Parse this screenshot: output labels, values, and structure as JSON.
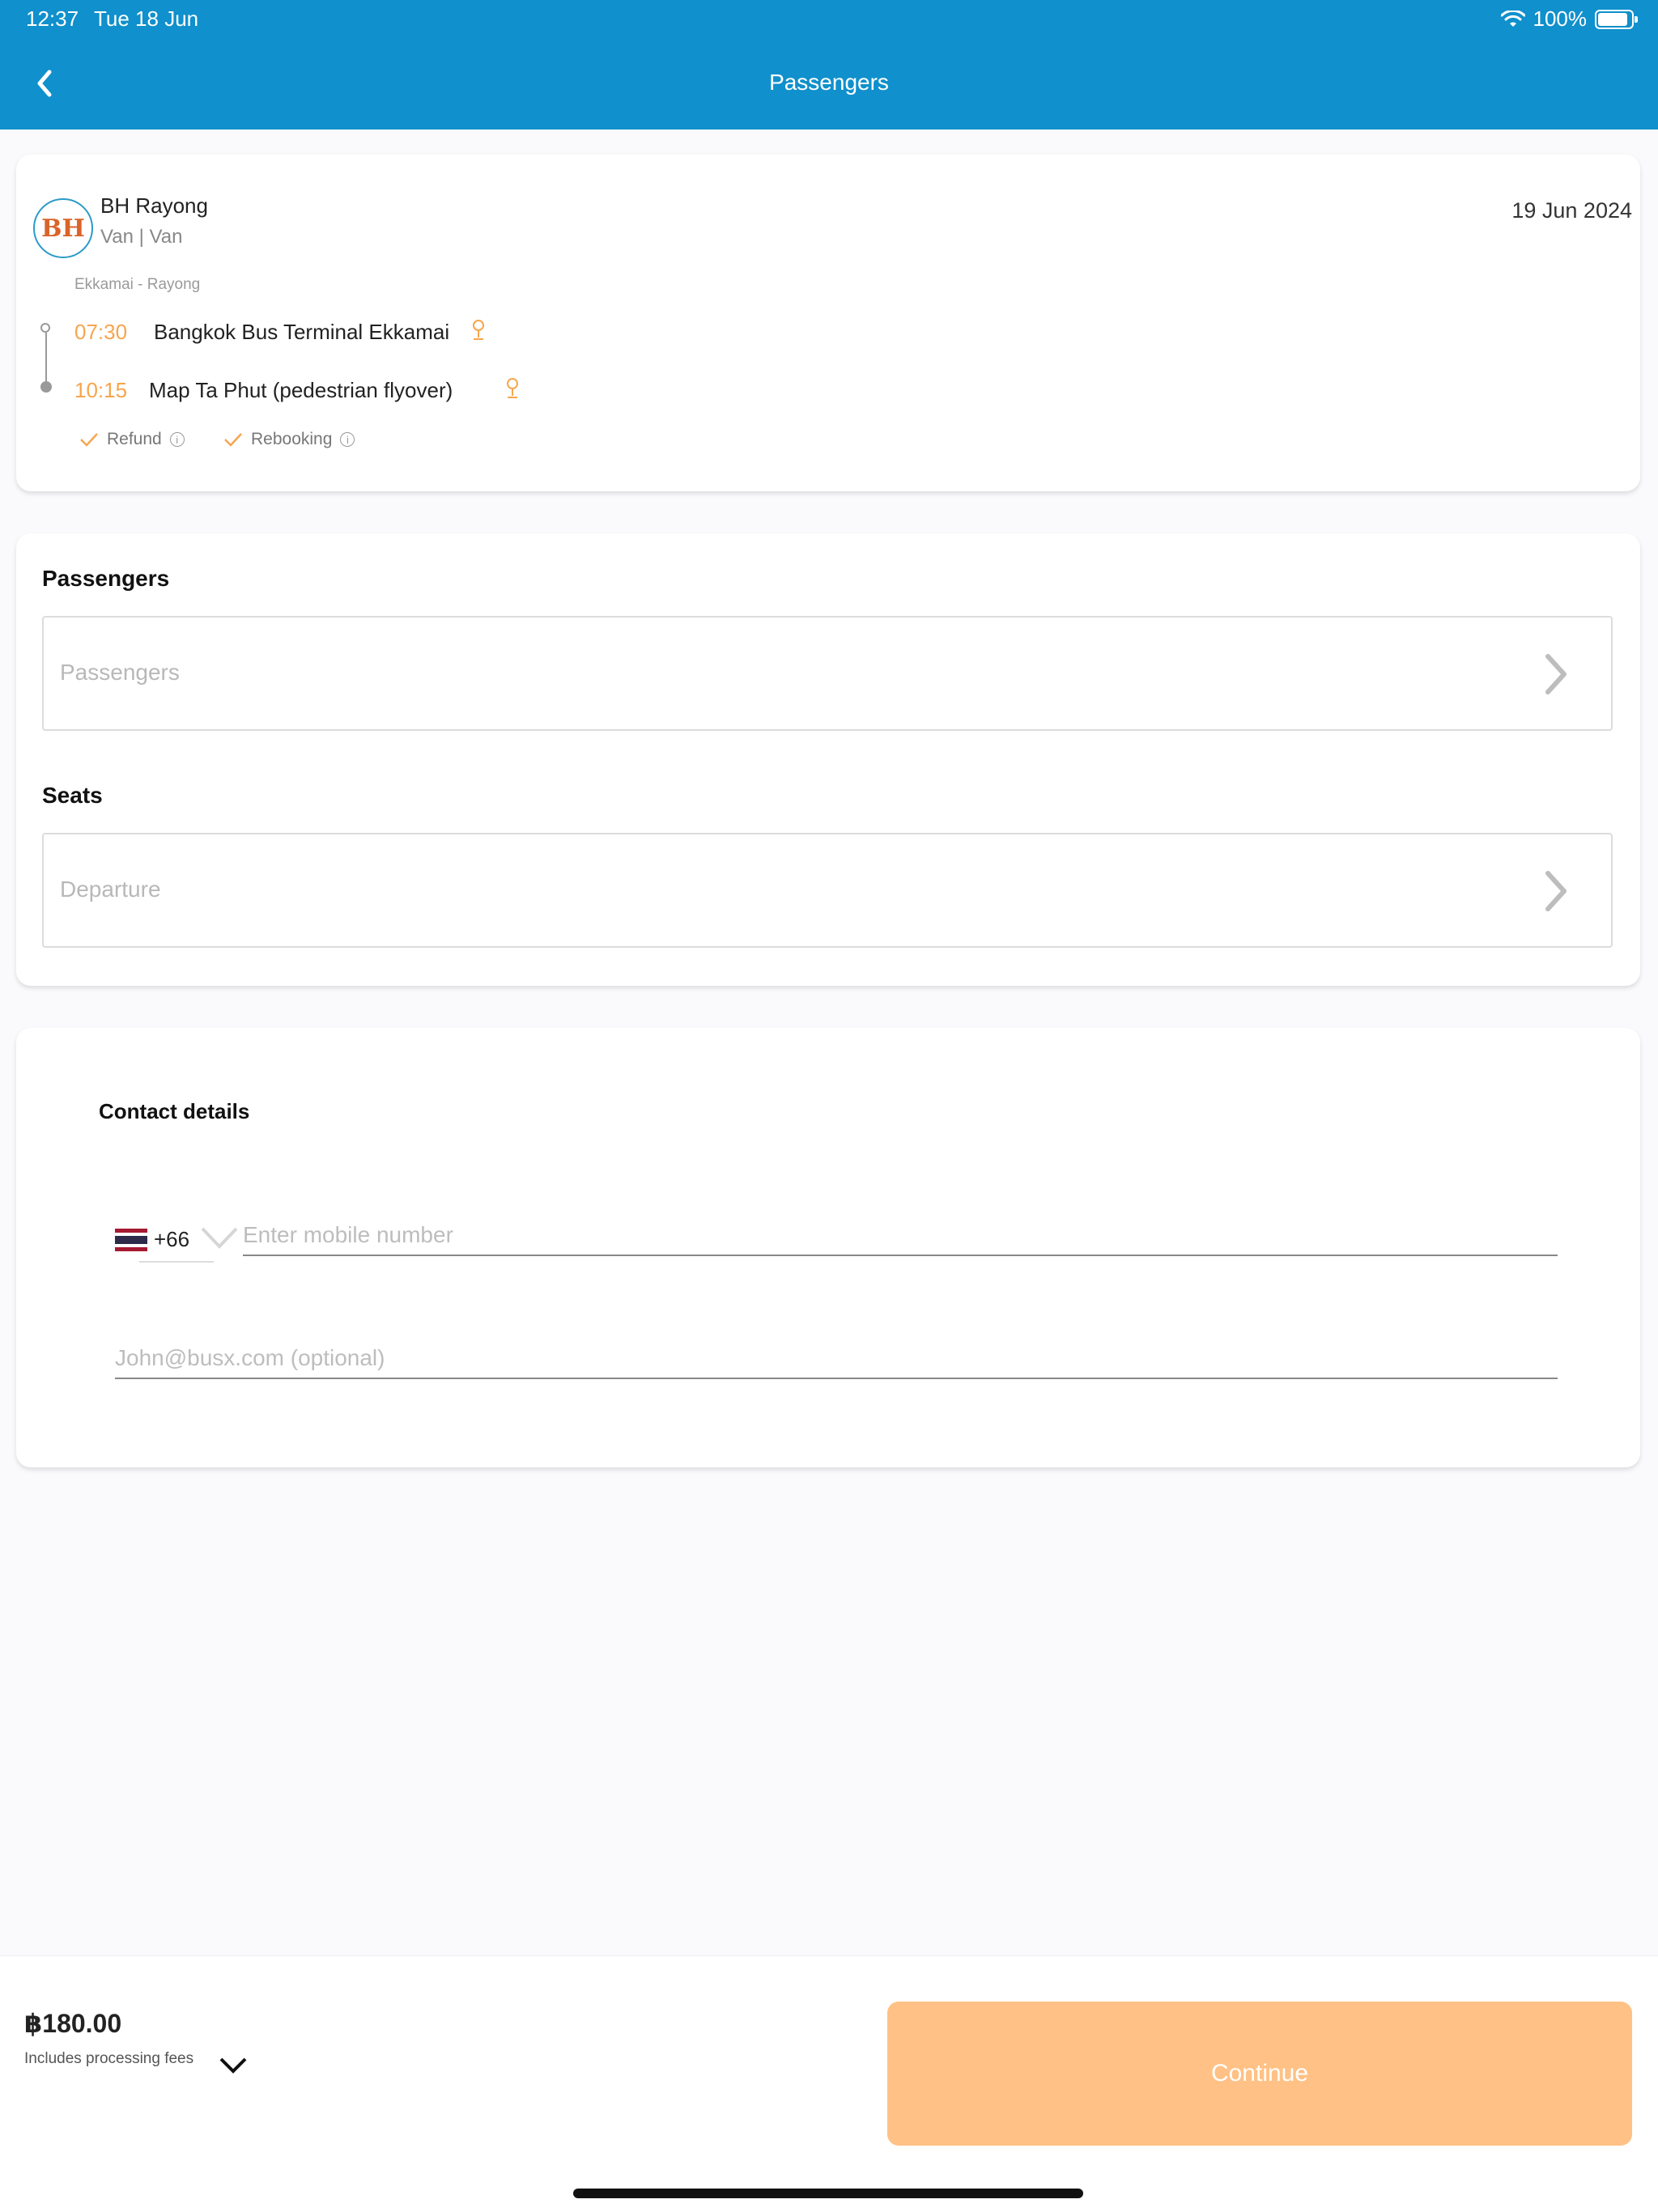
{
  "status_bar": {
    "time": "12:37",
    "date": "Tue 18 Jun",
    "battery": "100%",
    "battery_level": 1.0
  },
  "header": {
    "title": "Passengers",
    "back_icon": "chevron-left-icon"
  },
  "trip": {
    "operator_logo_text": "BH",
    "operator": "BH Rayong",
    "vehicle": "Van | Van",
    "date": "19 Jun 2024",
    "route": "Ekkamai - Rayong",
    "departure": {
      "time": "07:30",
      "place": "Bangkok Bus Terminal Ekkamai"
    },
    "arrival": {
      "time": "10:15",
      "place": "Map Ta Phut (pedestrian flyover)"
    },
    "policies": [
      {
        "label": "Refund"
      },
      {
        "label": "Rebooking"
      }
    ],
    "accent_color": "#f7a54d"
  },
  "passengers_section": {
    "passengers_label": "Passengers",
    "passengers_placeholder": "Passengers",
    "seats_label": "Seats",
    "seats_placeholder": "Departure"
  },
  "contact": {
    "title": "Contact details",
    "country_code": "+66",
    "phone_placeholder": "Enter mobile number",
    "email_placeholder": "John@busx.com (optional)"
  },
  "footer": {
    "price": "฿180.00",
    "fees_note": "Includes processing fees",
    "continue_label": "Continue",
    "continue_color": "#ffc185"
  },
  "colors": {
    "header": "#1090cc",
    "background": "#fafafc"
  }
}
